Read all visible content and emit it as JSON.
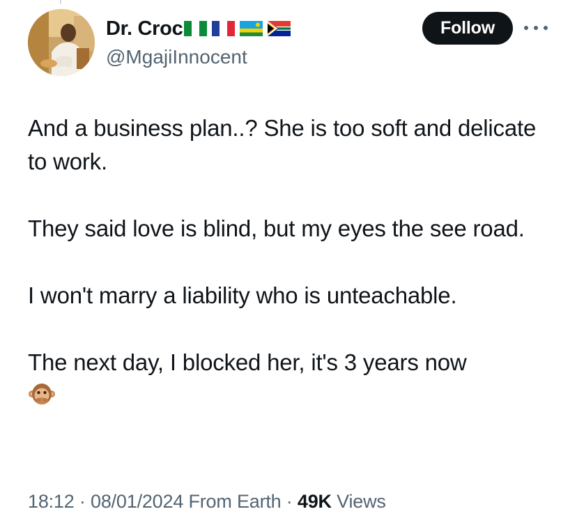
{
  "author": {
    "display_name": "Dr. Croc",
    "handle": "@MgajiInnocent",
    "flags": [
      "nigeria-flag",
      "france-flag",
      "rwanda-flag",
      "south-africa-flag"
    ]
  },
  "actions": {
    "follow_label": "Follow",
    "more_icon": "more-icon"
  },
  "tweet": {
    "paragraphs": [
      "And a business plan..? She is too soft and delicate to work.",
      "They said love is blind, but my eyes the see road.",
      "I won't marry a liability who is unteachable.",
      "The next day, I blocked her, it's 3 years now"
    ],
    "emoji": "speak-no-evil-monkey"
  },
  "meta": {
    "time": "18:12",
    "separator": "·",
    "date": "08/01/2024",
    "source": "From Earth",
    "views_count": "49K",
    "views_label": "Views"
  },
  "colors": {
    "text": "#0f1419",
    "secondary": "#536471",
    "button_bg": "#0f1419",
    "button_text": "#ffffff"
  }
}
